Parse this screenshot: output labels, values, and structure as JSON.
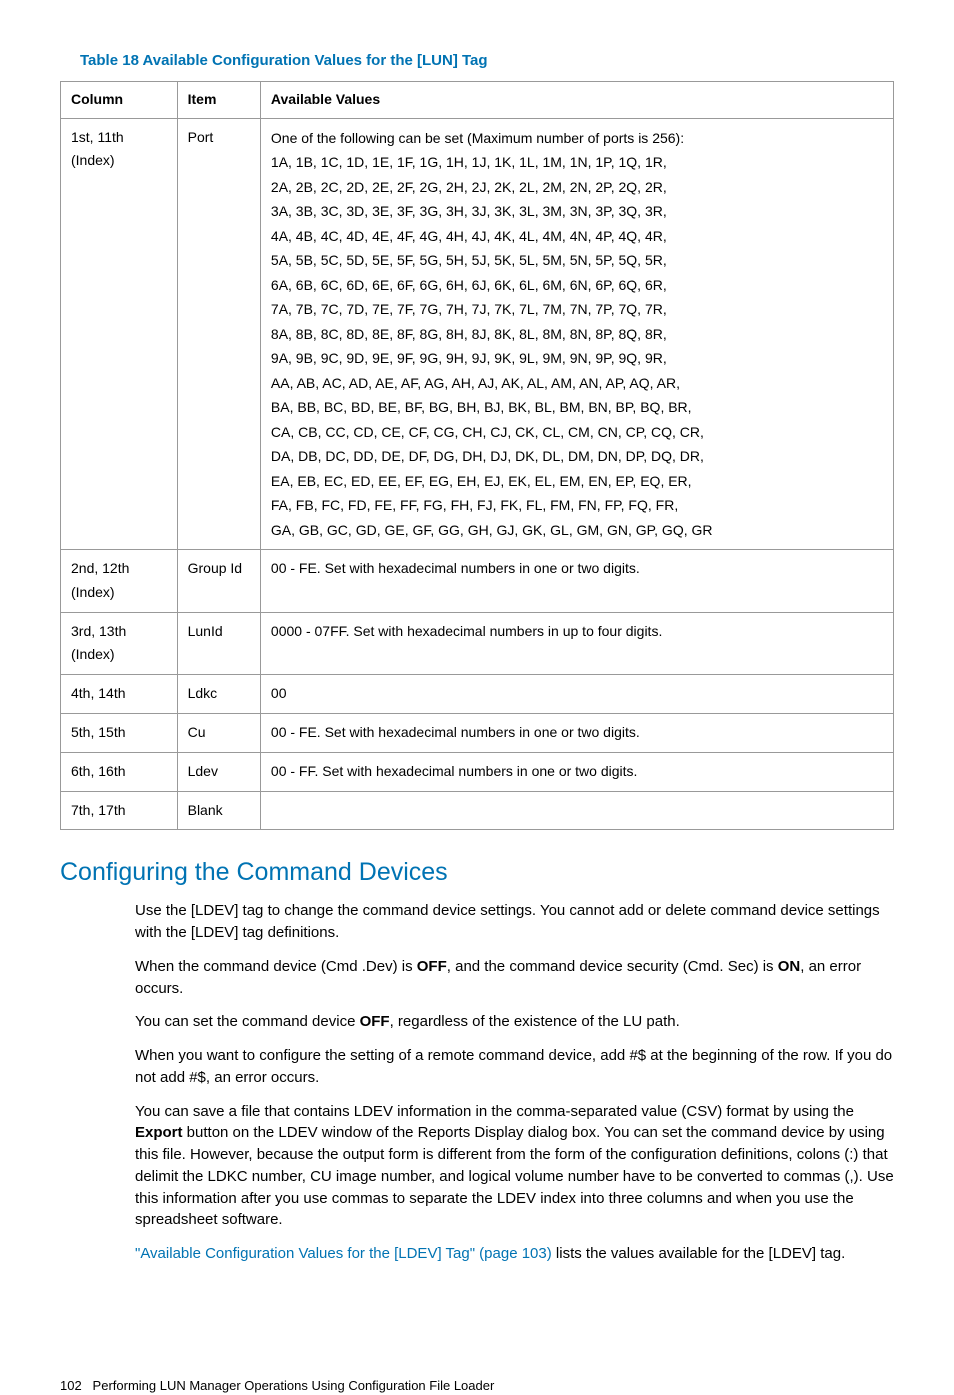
{
  "tableTitle": "Table 18 Available Configuration Values for the [LUN] Tag",
  "headers": {
    "c1": "Column",
    "c2": "Item",
    "c3": "Available Values"
  },
  "rows": [
    {
      "c1": "1st, 11th (Index)",
      "c2": "Port",
      "intro": "One of the following can be set (Maximum number of ports is 256):",
      "lines": [
        "1A, 1B, 1C, 1D, 1E, 1F, 1G, 1H, 1J, 1K, 1L, 1M, 1N, 1P, 1Q, 1R,",
        "2A, 2B, 2C, 2D, 2E, 2F, 2G, 2H, 2J, 2K, 2L, 2M, 2N, 2P, 2Q, 2R,",
        "3A, 3B, 3C, 3D, 3E, 3F, 3G, 3H, 3J, 3K, 3L, 3M, 3N, 3P, 3Q, 3R,",
        "4A, 4B, 4C, 4D, 4E, 4F, 4G, 4H, 4J, 4K, 4L, 4M, 4N, 4P, 4Q, 4R,",
        "5A, 5B, 5C, 5D, 5E, 5F, 5G, 5H, 5J, 5K, 5L, 5M, 5N, 5P, 5Q, 5R,",
        "6A, 6B, 6C, 6D, 6E, 6F, 6G, 6H, 6J, 6K, 6L, 6M, 6N, 6P, 6Q, 6R,",
        "7A, 7B, 7C, 7D, 7E, 7F, 7G, 7H, 7J, 7K, 7L, 7M, 7N, 7P, 7Q, 7R,",
        "8A, 8B, 8C, 8D, 8E, 8F, 8G, 8H, 8J, 8K, 8L, 8M, 8N, 8P, 8Q, 8R,",
        "9A, 9B, 9C, 9D, 9E, 9F, 9G, 9H, 9J, 9K, 9L, 9M, 9N, 9P, 9Q, 9R,",
        "AA, AB, AC, AD, AE, AF, AG, AH, AJ, AK, AL, AM, AN, AP, AQ, AR,",
        "BA, BB, BC, BD, BE, BF, BG, BH, BJ, BK, BL, BM, BN, BP, BQ, BR,",
        "CA, CB, CC, CD, CE, CF, CG, CH, CJ, CK, CL, CM, CN, CP, CQ, CR,",
        "DA, DB, DC, DD, DE, DF, DG, DH, DJ, DK, DL, DM, DN, DP, DQ, DR,",
        "EA, EB, EC, ED, EE, EF, EG, EH, EJ, EK, EL, EM, EN, EP, EQ, ER,",
        "FA, FB, FC, FD, FE, FF, FG, FH, FJ, FK, FL, FM, FN, FP, FQ, FR,",
        "GA, GB, GC, GD, GE, GF, GG, GH, GJ, GK, GL, GM, GN, GP, GQ, GR"
      ]
    },
    {
      "c1": "2nd, 12th (Index)",
      "c2": "Group Id",
      "c3": "00 - FE. Set with hexadecimal numbers in one or two digits."
    },
    {
      "c1": "3rd, 13th (Index)",
      "c2": "LunId",
      "c3": "0000 - 07FF. Set with hexadecimal numbers in up to four digits."
    },
    {
      "c1": "4th, 14th",
      "c2": "Ldkc",
      "c3": "00"
    },
    {
      "c1": "5th, 15th",
      "c2": "Cu",
      "c3": "00 - FE. Set with hexadecimal numbers in one or two digits."
    },
    {
      "c1": "6th, 16th",
      "c2": "Ldev",
      "c3": "00 - FF. Set with hexadecimal numbers in one or two digits."
    },
    {
      "c1": "7th, 17th",
      "c2": "Blank",
      "c3": ""
    }
  ],
  "sectionHeading": "Configuring the Command Devices",
  "p1": "Use the [LDEV] tag to change the command device settings. You cannot add or delete command device settings with the [LDEV] tag definitions.",
  "p2_a": "When the command device (Cmd .Dev) is ",
  "p2_off": "OFF",
  "p2_b": ", and the command device security (Cmd. Sec) is ",
  "p2_on": "ON",
  "p2_c": ", an error occurs.",
  "p3_a": "You can set the command device ",
  "p3_off": "OFF",
  "p3_b": ", regardless of the existence of the LU path.",
  "p4": "When you want to configure the setting of a remote command device, add #$ at the beginning of the row. If you do not add #$, an error occurs.",
  "p5_a": "You can save a file that contains LDEV information in the comma-separated value (CSV) format by using the ",
  "p5_export": "Export",
  "p5_b": " button on the LDEV window of the Reports Display dialog box. You can set the command device by using this file. However, because the output form is different from the form of the configuration definitions, colons (:) that delimit the LDKC number, CU image number, and logical volume number have to be converted to commas (,). Use this information after you use commas to separate the LDEV index into three columns and when you use the spreadsheet software.",
  "p6_link": "\"Available Configuration Values for the [LDEV] Tag\" (page 103)",
  "p6_b": " lists the values available for the [LDEV] tag.",
  "footer_page": "102",
  "footer_text": "Performing LUN Manager Operations Using Configuration File Loader"
}
